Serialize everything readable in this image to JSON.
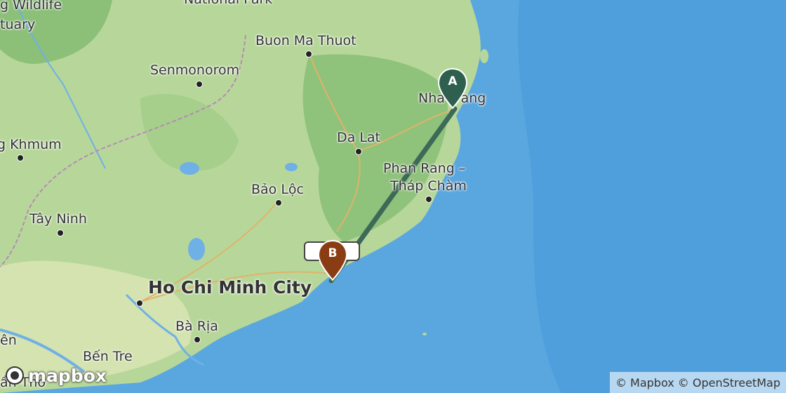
{
  "cities": {
    "buon_ma_thuot": "Buon Ma Thuot",
    "senmonorom": "Senmonorom",
    "nha_trang": "Nha Trang",
    "da_lat": "Da Lat",
    "phan_rang_1": "Phan Rang –",
    "phan_rang_2": "Tháp Chàm",
    "khmum": "g Khmum",
    "bao_loc": "Bảo Lộc",
    "tay_ninh": "Tây Ninh",
    "hcmc": "Ho Chi Minh City",
    "ba_ria": "Bà Rịa",
    "ben_tre": "Bến Tre",
    "can_tho": "ần Thơ",
    "ven": "ên",
    "wildlife_1": "g Wildlife",
    "wildlife_2": "tuary",
    "national_park": "National Park"
  },
  "markers": {
    "a": "A",
    "b": "B"
  },
  "colors": {
    "marker_a": "#2f5f4f",
    "marker_b": "#8a3d12",
    "route": "#3d6a58",
    "sea": "#5aa7e0",
    "land": "#b9d89a"
  },
  "logo": "mapbox",
  "attribution": "© Mapbox © OpenStreetMap"
}
